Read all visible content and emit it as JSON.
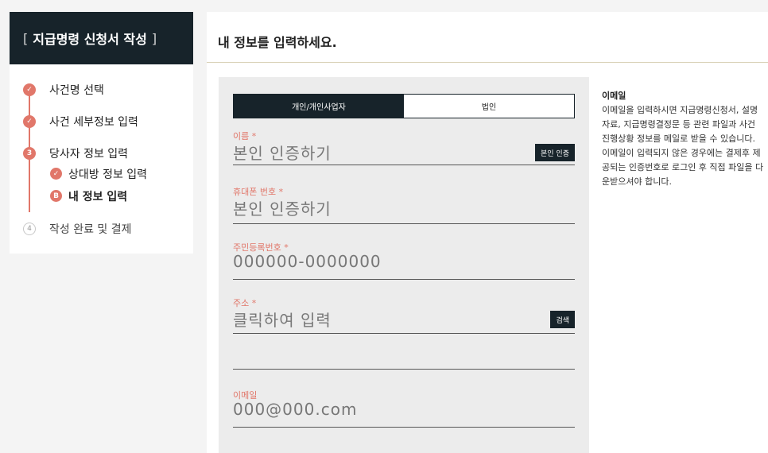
{
  "sidebar": {
    "title_bracket_open": "[",
    "title": "지급명령 신청서 작성",
    "title_bracket_close": "]",
    "steps": [
      {
        "label": "사건명 선택",
        "marker": "✓"
      },
      {
        "label": "사건 세부정보 입력",
        "marker": "✓"
      },
      {
        "label": "당사자 정보 입력",
        "marker": "3"
      },
      {
        "label": "상대방 정보 입력",
        "marker": "✓"
      },
      {
        "label": "내 정보 입력",
        "marker": "B"
      },
      {
        "label": "작성 완료 및 결제",
        "marker": "4"
      }
    ]
  },
  "main": {
    "title": "내 정보를 입력하세요.",
    "tabs": [
      {
        "label": "개인/개인사업자",
        "active": true
      },
      {
        "label": "법인",
        "active": false
      }
    ],
    "fields": {
      "name": {
        "label": "이름 *",
        "placeholder": "본인 인증하기",
        "button": "본인 인증"
      },
      "phone": {
        "label": "휴대폰 번호 *",
        "placeholder": "본인 인증하기"
      },
      "rrn": {
        "label": "주민등록번호 *",
        "placeholder": "000000-0000000"
      },
      "address": {
        "label": "주소 *",
        "placeholder": "클릭하여 입력",
        "button": "검색"
      },
      "email": {
        "label": "이메일",
        "placeholder": "000@000.com"
      }
    },
    "info": {
      "title": "이메일",
      "text": "이메일을 입력하시면 지급명령신청서, 설명자료, 지급명령결정문 등 관련 파일과 사건 진행상황 정보를 메일로 받을 수 있습니다. 이메일이 입력되지 않은 경우에는 결제후 제공되는 인증번호로 로그인 후 직접 파일을 다운받으셔야 합니다."
    }
  },
  "colors": {
    "accent": "#e1776a",
    "dark": "#17232a",
    "divider": "#d9d2b8"
  }
}
